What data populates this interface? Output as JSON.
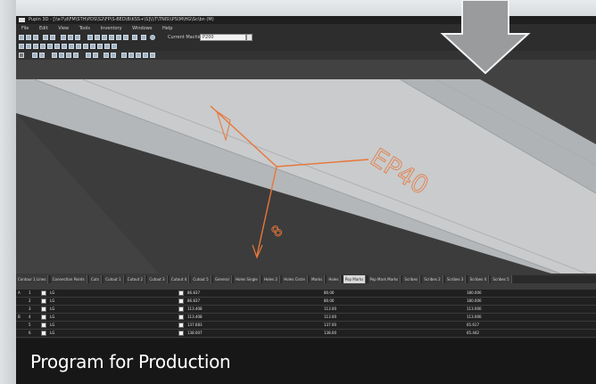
{
  "window": {
    "title": "Pupin 3D - [\\\\e7\\d\\FM\\STH\\PDS\\S2\\FP\\S-BED\\B\\KSS+\\S]\\\\\\T\\TNIS\\\\PS\\M\\HG\\Sc\\bn (M)"
  },
  "menu": [
    "File",
    "Edit",
    "View",
    "Tools",
    "Inventory",
    "Windows",
    "Help"
  ],
  "camera": {
    "label": "Current Machine",
    "value": "P200"
  },
  "viewport": {
    "labels": [
      "EP40",
      "8"
    ],
    "colors": {
      "plate": "#c9cbcc",
      "axis": "#e8763a",
      "background": "#424242"
    }
  },
  "tabs": [
    {
      "label": "Contour 1 Lines"
    },
    {
      "label": "Connection Points"
    },
    {
      "label": "Cuts"
    },
    {
      "label": "Cutout 1"
    },
    {
      "label": "Cutout 2"
    },
    {
      "label": "Cutout 3"
    },
    {
      "label": "Cutout 4"
    },
    {
      "label": "Cutout 5"
    },
    {
      "label": "General"
    },
    {
      "label": "Holes Single"
    },
    {
      "label": "Holes 2"
    },
    {
      "label": "Holes Circle"
    },
    {
      "label": "Marks"
    },
    {
      "label": "Holes"
    },
    {
      "label": "Pop Marks",
      "active": true
    },
    {
      "label": "Pop Mark Marks"
    },
    {
      "label": "Scribes"
    },
    {
      "label": "Scribes 2"
    },
    {
      "label": "Scribes 3"
    },
    {
      "label": "Scribes 4"
    },
    {
      "label": "Scribes 5"
    }
  ],
  "grid": {
    "rows": [
      {
        "a": "A",
        "b": "1",
        "ref": "LG",
        "x": "86.837",
        "y": "80.00",
        "z": "180.000"
      },
      {
        "a": "",
        "b": "2",
        "ref": "LG",
        "x": "86.837",
        "y": "80.00",
        "z": "180.000"
      },
      {
        "a": "",
        "b": "3",
        "ref": "LG",
        "x": "113.408",
        "y": "113.00",
        "z": "113.000"
      },
      {
        "a": "B",
        "b": "4",
        "ref": "LG",
        "x": "113.408",
        "y": "113.00",
        "z": "113.000"
      },
      {
        "a": "",
        "b": "5",
        "ref": "LG",
        "x": "137.683",
        "y": "137.00",
        "z": "65.617"
      },
      {
        "a": "",
        "b": "6",
        "ref": "LG",
        "x": "138.007",
        "y": "138.00",
        "z": "65.442"
      }
    ]
  },
  "caption": {
    "text": "Program for Production"
  }
}
